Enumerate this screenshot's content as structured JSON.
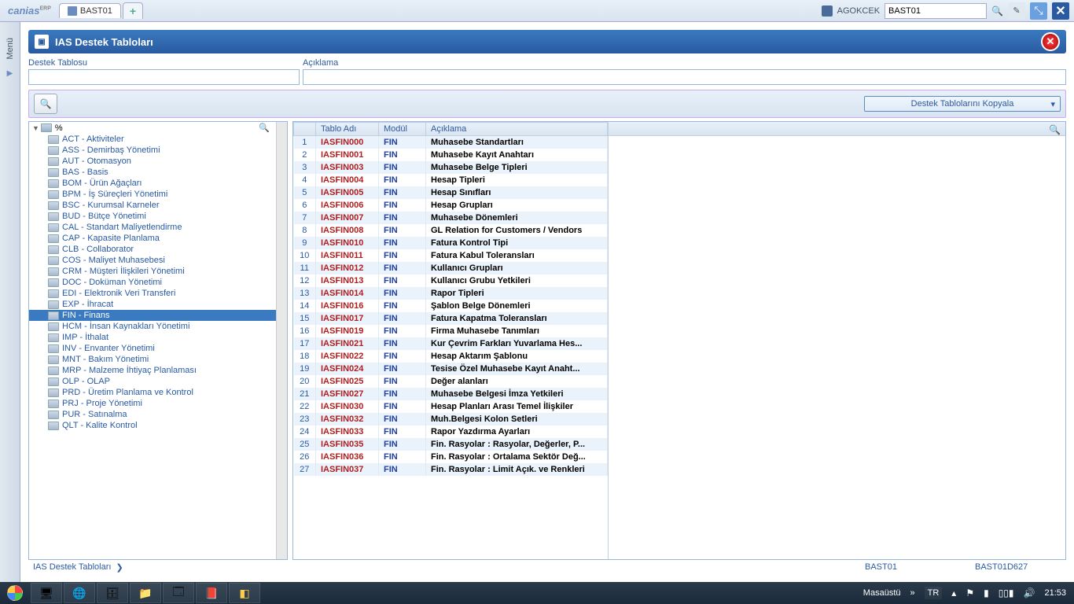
{
  "app": {
    "logo": "canias",
    "logo_sup": "ERP"
  },
  "tabs": {
    "active": "BAST01"
  },
  "user": {
    "name": "AGOKCEK"
  },
  "search": {
    "value": "BAST01"
  },
  "menu_tab": {
    "label": "Menü"
  },
  "page": {
    "title": "IAS Destek Tabloları",
    "filter_table_label": "Destek Tablosu",
    "filter_desc_label": "Açıklama",
    "copy_label": "Destek Tablolarını Kopyala"
  },
  "tree": {
    "root": "%",
    "selected": "FIN - Finans",
    "items": [
      "ACT - Aktiviteler",
      "ASS - Demirbaş Yönetimi",
      "AUT - Otomasyon",
      "BAS - Basis",
      "BOM - Ürün Ağaçları",
      "BPM - İş Süreçleri Yönetimi",
      "BSC - Kurumsal Karneler",
      "BUD - Bütçe Yönetimi",
      "CAL - Standart Maliyetlendirme",
      "CAP - Kapasite Planlama",
      "CLB - Collaborator",
      "COS - Maliyet Muhasebesi",
      "CRM - Müşteri İlişkileri Yönetimi",
      "DOC - Doküman Yönetimi",
      "EDI - Elektronik Veri Transferi",
      "EXP - İhracat",
      "FIN - Finans",
      "HCM - İnsan Kaynakları Yönetimi",
      "IMP - İthalat",
      "INV - Envanter Yönetimi",
      "MNT - Bakım Yönetimi",
      "MRP - Malzeme İhtiyaç Planlaması",
      "OLP - OLAP",
      "PRD - Üretim Planlama ve Kontrol",
      "PRJ - Proje Yönetimi",
      "PUR - Satınalma",
      "QLT - Kalite Kontrol"
    ]
  },
  "table": {
    "headers": {
      "name": "Tablo Adı",
      "module": "Modül",
      "desc": "Açıklama"
    },
    "rows": [
      {
        "n": "1",
        "name": "IASFIN000",
        "module": "FIN",
        "desc": "Muhasebe Standartları"
      },
      {
        "n": "2",
        "name": "IASFIN001",
        "module": "FIN",
        "desc": "Muhasebe Kayıt Anahtarı"
      },
      {
        "n": "3",
        "name": "IASFIN003",
        "module": "FIN",
        "desc": "Muhasebe Belge Tipleri"
      },
      {
        "n": "4",
        "name": "IASFIN004",
        "module": "FIN",
        "desc": "Hesap Tipleri"
      },
      {
        "n": "5",
        "name": "IASFIN005",
        "module": "FIN",
        "desc": "Hesap Sınıfları"
      },
      {
        "n": "6",
        "name": "IASFIN006",
        "module": "FIN",
        "desc": "Hesap Grupları"
      },
      {
        "n": "7",
        "name": "IASFIN007",
        "module": "FIN",
        "desc": "Muhasebe Dönemleri"
      },
      {
        "n": "8",
        "name": "IASFIN008",
        "module": "FIN",
        "desc": "GL Relation for Customers / Vendors"
      },
      {
        "n": "9",
        "name": "IASFIN010",
        "module": "FIN",
        "desc": "Fatura Kontrol Tipi"
      },
      {
        "n": "10",
        "name": "IASFIN011",
        "module": "FIN",
        "desc": "Fatura Kabul Toleransları"
      },
      {
        "n": "11",
        "name": "IASFIN012",
        "module": "FIN",
        "desc": "Kullanıcı Grupları"
      },
      {
        "n": "12",
        "name": "IASFIN013",
        "module": "FIN",
        "desc": "Kullanıcı Grubu Yetkileri"
      },
      {
        "n": "13",
        "name": "IASFIN014",
        "module": "FIN",
        "desc": "Rapor Tipleri"
      },
      {
        "n": "14",
        "name": "IASFIN016",
        "module": "FIN",
        "desc": "Şablon Belge Dönemleri"
      },
      {
        "n": "15",
        "name": "IASFIN017",
        "module": "FIN",
        "desc": "Fatura Kapatma Toleransları"
      },
      {
        "n": "16",
        "name": "IASFIN019",
        "module": "FIN",
        "desc": "Firma Muhasebe Tanımları"
      },
      {
        "n": "17",
        "name": "IASFIN021",
        "module": "FIN",
        "desc": "Kur Çevrim Farkları Yuvarlama Hes..."
      },
      {
        "n": "18",
        "name": "IASFIN022",
        "module": "FIN",
        "desc": "Hesap Aktarım Şablonu"
      },
      {
        "n": "19",
        "name": "IASFIN024",
        "module": "FIN",
        "desc": "Tesise Özel Muhasebe Kayıt Anaht..."
      },
      {
        "n": "20",
        "name": "IASFIN025",
        "module": "FIN",
        "desc": "Değer alanları"
      },
      {
        "n": "21",
        "name": "IASFIN027",
        "module": "FIN",
        "desc": "Muhasebe Belgesi İmza Yetkileri"
      },
      {
        "n": "22",
        "name": "IASFIN030",
        "module": "FIN",
        "desc": "Hesap Planları Arası Temel İlişkiler"
      },
      {
        "n": "23",
        "name": "IASFIN032",
        "module": "FIN",
        "desc": "Muh.Belgesi Kolon Setleri"
      },
      {
        "n": "24",
        "name": "IASFIN033",
        "module": "FIN",
        "desc": "Rapor Yazdırma Ayarları"
      },
      {
        "n": "25",
        "name": "IASFIN035",
        "module": "FIN",
        "desc": "Fin. Rasyolar : Rasyolar, Değerler, P..."
      },
      {
        "n": "26",
        "name": "IASFIN036",
        "module": "FIN",
        "desc": "Fin. Rasyolar : Ortalama Sektör Değ..."
      },
      {
        "n": "27",
        "name": "IASFIN037",
        "module": "FIN",
        "desc": "Fin. Rasyolar : Limit Açık. ve Renkleri"
      }
    ]
  },
  "breadcrumb": {
    "left": "IAS Destek Tabloları",
    "code1": "BAST01",
    "code2": "BAST01D627"
  },
  "taskbar": {
    "desktop": "Masaüstü",
    "lang": "TR",
    "time": "21:53"
  }
}
